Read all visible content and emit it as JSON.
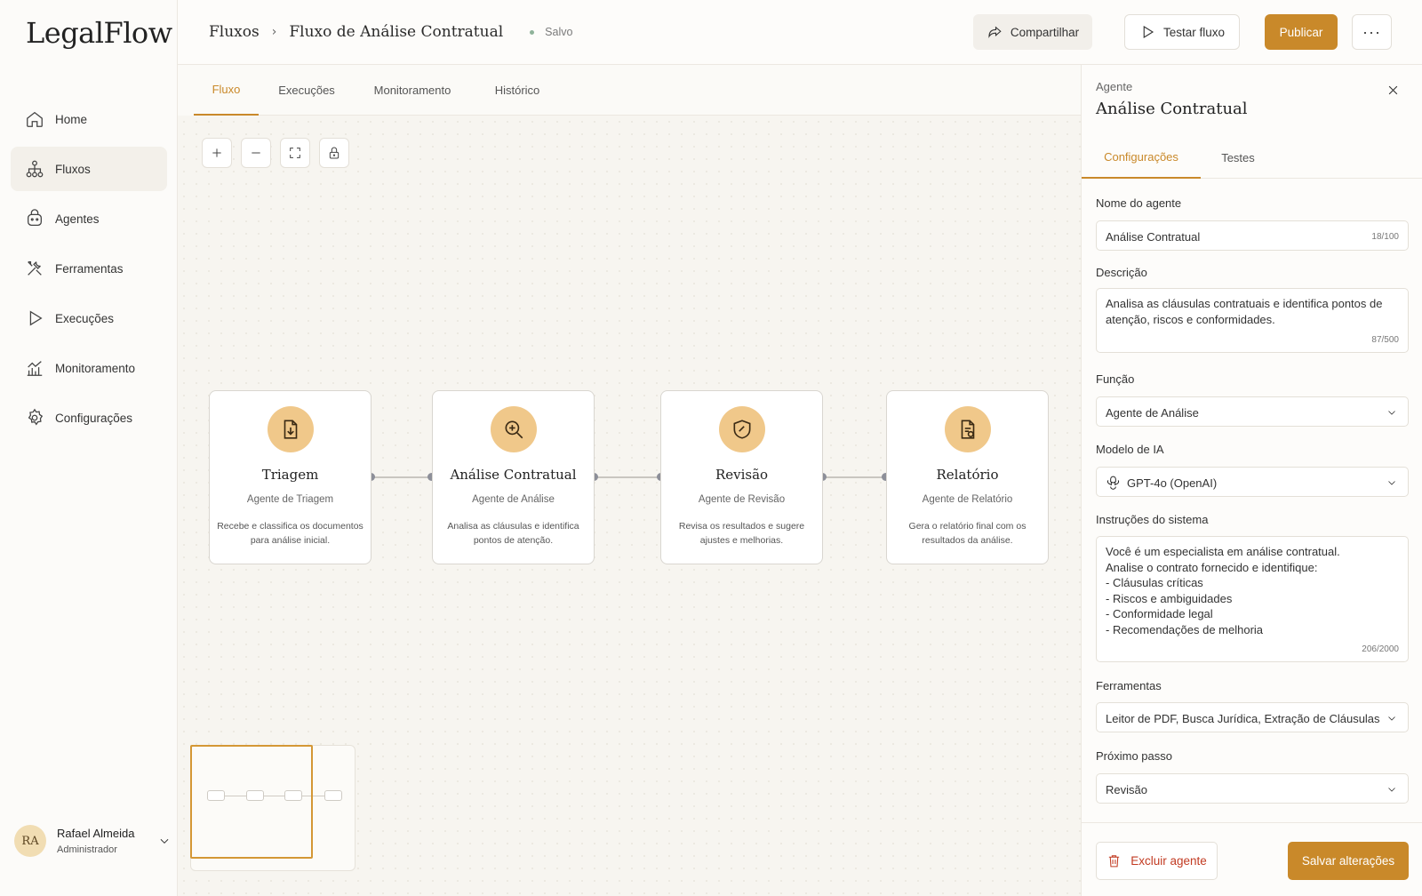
{
  "app": {
    "logo": "LegalFlow"
  },
  "sidebar": {
    "items": [
      {
        "label": "Home",
        "icon": "home-icon"
      },
      {
        "label": "Fluxos",
        "icon": "flow-icon",
        "active": true
      },
      {
        "label": "Agentes",
        "icon": "agent-icon"
      },
      {
        "label": "Ferramentas",
        "icon": "tools-icon"
      },
      {
        "label": "Execuções",
        "icon": "play-icon"
      },
      {
        "label": "Monitoramento",
        "icon": "chart-icon"
      },
      {
        "label": "Configurações",
        "icon": "gear-icon"
      }
    ],
    "user": {
      "initials": "RA",
      "name": "Rafael Almeida",
      "role": "Administrador"
    }
  },
  "header": {
    "breadcrumb_root": "Fluxos",
    "breadcrumb_current": "Fluxo de Análise Contratual",
    "status": "Salvo",
    "share_label": "Compartilhar",
    "test_label": "Testar fluxo",
    "publish_label": "Publicar",
    "more_label": "···"
  },
  "tabs": [
    {
      "label": "Fluxo",
      "active": true
    },
    {
      "label": "Execuções"
    },
    {
      "label": "Monitoramento"
    },
    {
      "label": "Histórico"
    }
  ],
  "nodes": [
    {
      "title": "Triagem",
      "subtitle": "Agente de Triagem",
      "desc1": "Recebe e classifica os documentos",
      "desc2": "para análise inicial.",
      "icon": "document-download-icon"
    },
    {
      "title": "Análise Contratual",
      "subtitle": "Agente de Análise",
      "desc1": "Analisa as cláusulas e identifica",
      "desc2": "pontos de atenção.",
      "icon": "magnifier-icon"
    },
    {
      "title": "Revisão",
      "subtitle": "Agente de Revisão",
      "desc1": "Revisa os resultados e sugere",
      "desc2": "ajustes e melhorias.",
      "icon": "shield-icon"
    },
    {
      "title": "Relatório",
      "subtitle": "Agente de Relatório",
      "desc1": "Gera o relatório final com os",
      "desc2": "resultados da análise.",
      "icon": "report-icon"
    }
  ],
  "panel": {
    "kicker": "Agente",
    "title": "Análise Contratual",
    "tabs": [
      {
        "label": "Configurações",
        "active": true
      },
      {
        "label": "Testes"
      }
    ],
    "name_label": "Nome do agente",
    "name_value": "Análise Contratual",
    "name_count": "18/100",
    "desc_label": "Descrição",
    "desc_value": "Analisa as cláusulas contratuais e identifica pontos de atenção, riscos e conformidades.",
    "desc_count": "87/500",
    "role_label": "Função",
    "role_value": "Agente de Análise",
    "model_label": "Modelo de IA",
    "model_value": "GPT-4o (OpenAI)",
    "instr_label": "Instruções do sistema",
    "instr_value": "Você é um especialista em análise contratual.\nAnalise o contrato fornecido e identifique:\n- Cláusulas críticas\n- Riscos e ambiguidades\n- Conformidade legal\n- Recomendações de melhoria",
    "instr_count": "206/2000",
    "tools_label": "Ferramentas",
    "tools_value": "Leitor de PDF, Busca Jurídica, Extração de Cláusulas",
    "next_label": "Próximo passo",
    "next_value": "Revisão",
    "delete_label": "Excluir agente",
    "save_label": "Salvar alterações"
  },
  "colors": {
    "accent": "#c9892a",
    "danger": "#c23b22",
    "node_icon_bg": "#f0c88a"
  }
}
